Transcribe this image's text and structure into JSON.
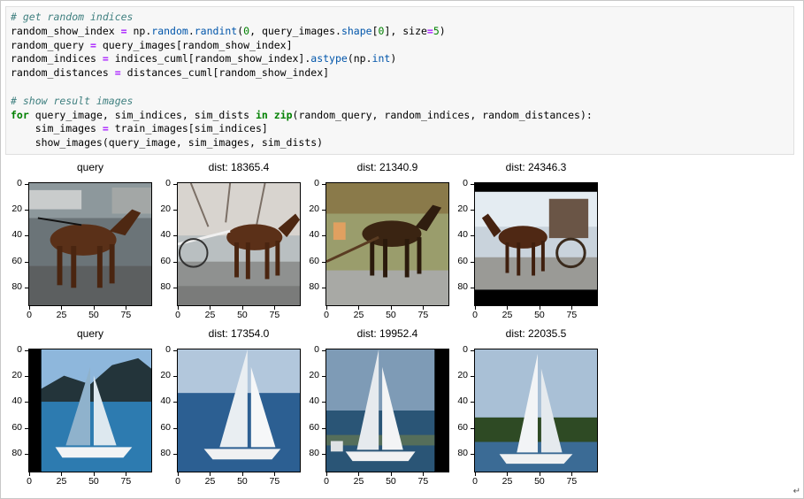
{
  "code": {
    "lines": [
      [
        {
          "t": "# get random indices",
          "c": "com"
        }
      ],
      [
        {
          "t": "random_show_index "
        },
        {
          "t": "=",
          "c": "op"
        },
        {
          "t": " np."
        },
        {
          "t": "random",
          "c": "attr"
        },
        {
          "t": "."
        },
        {
          "t": "randint",
          "c": "attr"
        },
        {
          "t": "("
        },
        {
          "t": "0",
          "c": "num"
        },
        {
          "t": ", query_images."
        },
        {
          "t": "shape",
          "c": "attr"
        },
        {
          "t": "["
        },
        {
          "t": "0",
          "c": "num"
        },
        {
          "t": "], size"
        },
        {
          "t": "=",
          "c": "op"
        },
        {
          "t": "5",
          "c": "num"
        },
        {
          "t": ")"
        }
      ],
      [
        {
          "t": "random_query "
        },
        {
          "t": "=",
          "c": "op"
        },
        {
          "t": " query_images[random_show_index]"
        }
      ],
      [
        {
          "t": "random_indices "
        },
        {
          "t": "=",
          "c": "op"
        },
        {
          "t": " indices_cuml[random_show_index]."
        },
        {
          "t": "astype",
          "c": "attr"
        },
        {
          "t": "(np."
        },
        {
          "t": "int",
          "c": "attr"
        },
        {
          "t": ")"
        }
      ],
      [
        {
          "t": "random_distances "
        },
        {
          "t": "=",
          "c": "op"
        },
        {
          "t": " distances_cuml[random_show_index]"
        }
      ],
      [
        {
          "t": ""
        }
      ],
      [
        {
          "t": "# show result images",
          "c": "com"
        }
      ],
      [
        {
          "t": "for",
          "c": "kw"
        },
        {
          "t": " query_image, sim_indices, sim_dists "
        },
        {
          "t": "in",
          "c": "kw"
        },
        {
          "t": " "
        },
        {
          "t": "zip",
          "c": "kw"
        },
        {
          "t": "(random_query, random_indices, random_distances):"
        }
      ],
      [
        {
          "t": "    sim_images "
        },
        {
          "t": "=",
          "c": "op"
        },
        {
          "t": " train_images[sim_indices]"
        }
      ],
      [
        {
          "t": "    show_images(query_image, sim_images, sim_dists)"
        }
      ]
    ]
  },
  "axis": {
    "y_ticks": [
      "0",
      "20",
      "40",
      "60",
      "80"
    ],
    "x_ticks": [
      "0",
      "25",
      "50",
      "75"
    ]
  },
  "rows": [
    {
      "panels": [
        {
          "title": "query",
          "image": "horse-carriage-query"
        },
        {
          "title": "dist: 18365.4",
          "image": "horse-carriage-street"
        },
        {
          "title": "dist: 21340.9",
          "image": "horse-cart-field"
        },
        {
          "title": "dist: 24346.3",
          "image": "horse-carriage-letterbox"
        }
      ]
    },
    {
      "panels": [
        {
          "title": "query",
          "image": "sailboat-mountains"
        },
        {
          "title": "dist: 17354.0",
          "image": "sailboat-open-sea"
        },
        {
          "title": "dist: 19952.4",
          "image": "sailboat-race"
        },
        {
          "title": "dist: 22035.5",
          "image": "sailboat-treeline"
        }
      ]
    }
  ],
  "colors": {
    "code_bg": "#f7f7f7",
    "comment": "#408080",
    "keyword": "#008000"
  }
}
